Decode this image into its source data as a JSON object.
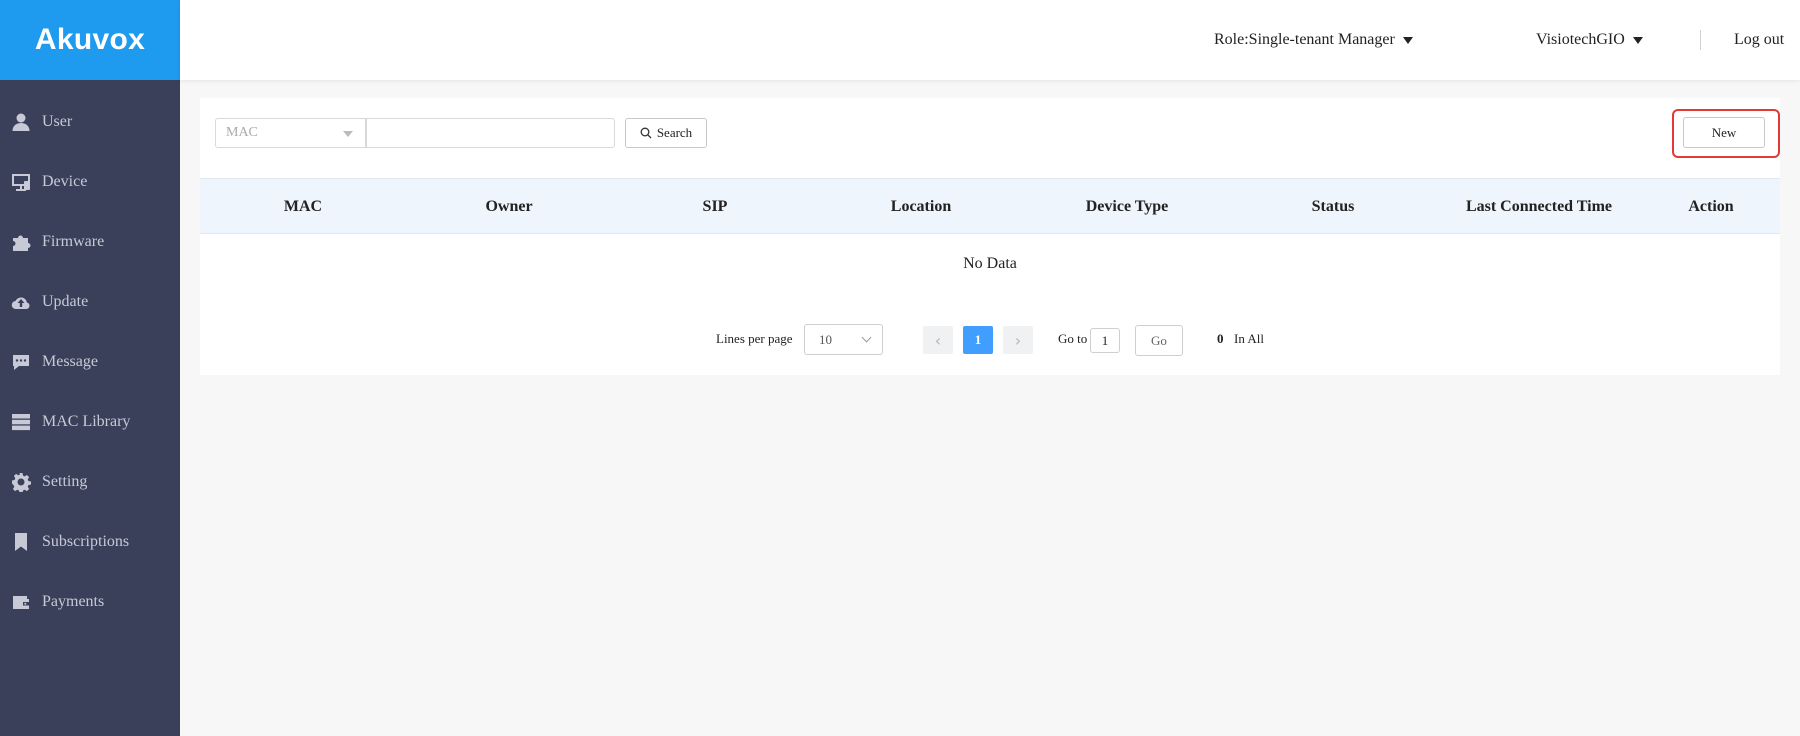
{
  "brand": {
    "logo": "Akuvox",
    "color": "#1e9aef"
  },
  "sidebar": {
    "background": "#3a4059",
    "items": [
      {
        "label": "User",
        "icon": "user-icon"
      },
      {
        "label": "Device",
        "icon": "device-icon"
      },
      {
        "label": "Firmware",
        "icon": "puzzle-icon"
      },
      {
        "label": "Update",
        "icon": "cloud-upload-icon"
      },
      {
        "label": "Message",
        "icon": "message-icon"
      },
      {
        "label": "MAC Library",
        "icon": "server-icon"
      },
      {
        "label": "Setting",
        "icon": "gear-icon"
      },
      {
        "label": "Subscriptions",
        "icon": "bookmark-icon"
      },
      {
        "label": "Payments",
        "icon": "wallet-icon"
      }
    ]
  },
  "header": {
    "role": "Role:Single-tenant Manager",
    "account": "VisiotechGIO",
    "logout": "Log out"
  },
  "toolbar": {
    "filter_field": "MAC",
    "search_value": "",
    "search_label": "Search",
    "new_label": "New"
  },
  "table": {
    "columns": [
      "MAC",
      "Owner",
      "SIP",
      "Location",
      "Device Type",
      "Status",
      "Last Connected Time",
      "Action"
    ],
    "empty_text": "No Data"
  },
  "pagination": {
    "lines_label": "Lines per page",
    "lines_value": "10",
    "prev": "‹",
    "next": "›",
    "current_page": "1",
    "goto_label": "Go to",
    "goto_value": "1",
    "go_label": "Go",
    "total": "0",
    "total_label": "In All",
    "accent": "#409eff"
  }
}
